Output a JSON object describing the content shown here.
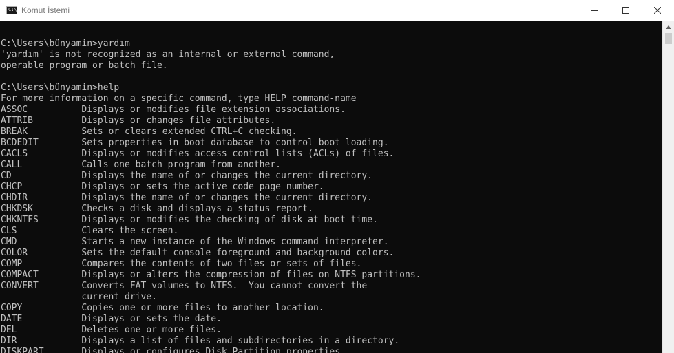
{
  "window": {
    "title": "Komut İstemi"
  },
  "console": {
    "lines": [
      "",
      "C:\\Users\\bünyamin>yardım",
      "'yardım' is not recognized as an internal or external command,",
      "operable program or batch file.",
      "",
      "C:\\Users\\bünyamin>help",
      "For more information on a specific command, type HELP command-name",
      "ASSOC          Displays or modifies file extension associations.",
      "ATTRIB         Displays or changes file attributes.",
      "BREAK          Sets or clears extended CTRL+C checking.",
      "BCDEDIT        Sets properties in boot database to control boot loading.",
      "CACLS          Displays or modifies access control lists (ACLs) of files.",
      "CALL           Calls one batch program from another.",
      "CD             Displays the name of or changes the current directory.",
      "CHCP           Displays or sets the active code page number.",
      "CHDIR          Displays the name of or changes the current directory.",
      "CHKDSK         Checks a disk and displays a status report.",
      "CHKNTFS        Displays or modifies the checking of disk at boot time.",
      "CLS            Clears the screen.",
      "CMD            Starts a new instance of the Windows command interpreter.",
      "COLOR          Sets the default console foreground and background colors.",
      "COMP           Compares the contents of two files or sets of files.",
      "COMPACT        Displays or alters the compression of files on NTFS partitions.",
      "CONVERT        Converts FAT volumes to NTFS.  You cannot convert the",
      "               current drive.",
      "COPY           Copies one or more files to another location.",
      "DATE           Displays or sets the date.",
      "DEL            Deletes one or more files.",
      "DIR            Displays a list of files and subdirectories in a directory.",
      "DISKPART       Displays or configures Disk Partition properties."
    ]
  },
  "colors": {
    "console_bg": "#0c0c0c",
    "console_fg": "#c0c0c0",
    "titlebar_bg": "#ffffff",
    "title_text": "#7a7a7a"
  },
  "icons": {
    "app": "cmd-icon",
    "minimize": "minimize-icon",
    "maximize": "maximize-icon",
    "close": "close-icon",
    "scroll_up": "scroll-up-arrow-icon"
  }
}
